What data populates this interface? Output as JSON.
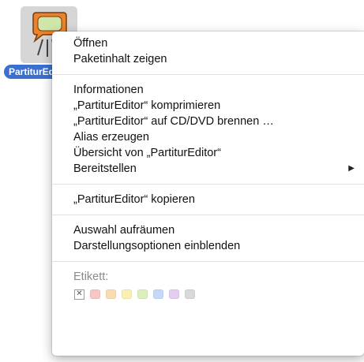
{
  "desktop_icon": {
    "label": "PartiturEditor",
    "icon": "speech-bubble-app-icon",
    "selected_color": "#3b6fd0"
  },
  "menu": {
    "sections": [
      {
        "items": [
          {
            "label": "Öffnen"
          },
          {
            "label": "Paketinhalt zeigen"
          }
        ]
      },
      {
        "items": [
          {
            "label": "Informationen"
          },
          {
            "label": "„PartiturEditor“ komprimieren"
          },
          {
            "label": "„PartiturEditor“ auf CD/DVD brennen …"
          },
          {
            "label": "Alias erzeugen"
          },
          {
            "label": "Übersicht von „PartiturEditor“"
          },
          {
            "label": "Bereitstellen",
            "submenu": "▶"
          }
        ]
      },
      {
        "items": [
          {
            "label": "„PartiturEditor“ kopieren"
          }
        ]
      },
      {
        "items": [
          {
            "label": "Auswahl aufräumen"
          },
          {
            "label": "Darstellungsoptionen einblenden"
          }
        ]
      }
    ],
    "labels": {
      "heading": "Etikett:",
      "none_glyph": "✕",
      "colors": [
        "#f7c6c6",
        "#fadcb2",
        "#f8f0b4",
        "#dcefbe",
        "#c5d9f7",
        "#e3cdf1",
        "#d9d9d9"
      ]
    }
  }
}
